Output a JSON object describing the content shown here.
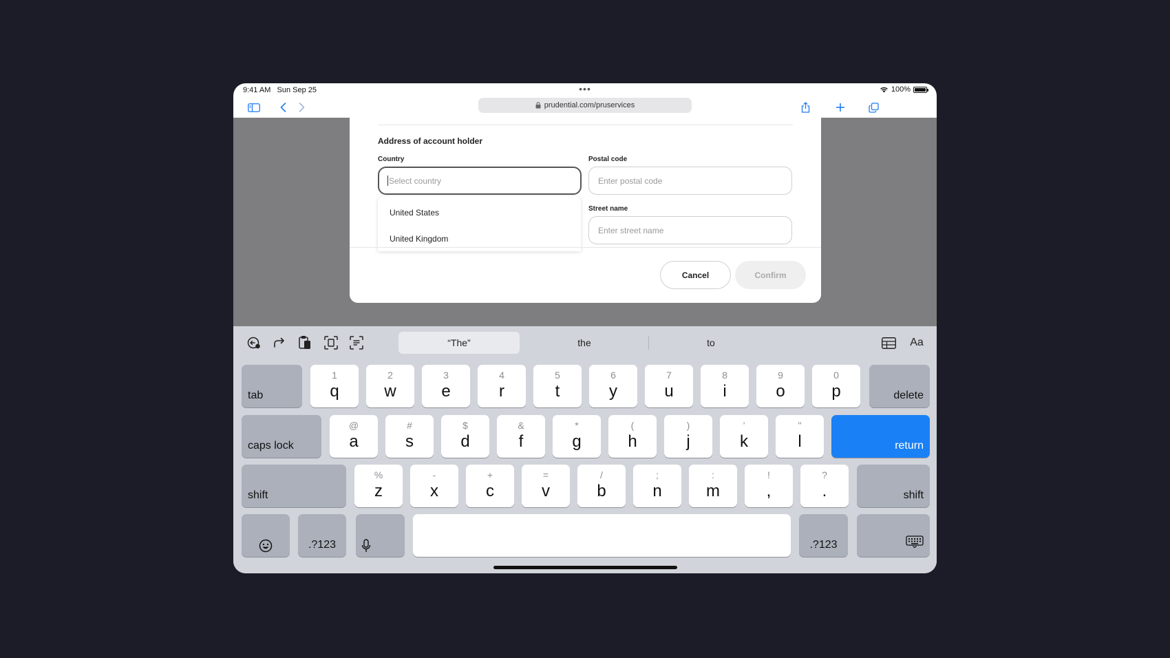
{
  "status": {
    "time": "9:41 AM",
    "date": "Sun Sep 25",
    "dots": "•••",
    "battery": "100%"
  },
  "browser": {
    "url": "prudential.com/pruservices"
  },
  "form": {
    "section_title": "Address of account holder",
    "country_label": "Country",
    "country_placeholder": "Select country",
    "postal_label": "Postal code",
    "postal_placeholder": "Enter postal code",
    "street_label": "Street name",
    "street_placeholder": "Enter street name",
    "country_options": [
      "United States",
      "United Kingdom"
    ],
    "cancel": "Cancel",
    "confirm": "Confirm"
  },
  "keyboard": {
    "suggestions": [
      "“The”",
      "the",
      "to"
    ],
    "format_label": "Aa",
    "row1": [
      {
        "alt": "1",
        "main": "q"
      },
      {
        "alt": "2",
        "main": "w"
      },
      {
        "alt": "3",
        "main": "e"
      },
      {
        "alt": "4",
        "main": "r"
      },
      {
        "alt": "5",
        "main": "t"
      },
      {
        "alt": "6",
        "main": "y"
      },
      {
        "alt": "7",
        "main": "u"
      },
      {
        "alt": "8",
        "main": "i"
      },
      {
        "alt": "9",
        "main": "o"
      },
      {
        "alt": "0",
        "main": "p"
      }
    ],
    "row2": [
      {
        "alt": "@",
        "main": "a"
      },
      {
        "alt": "#",
        "main": "s"
      },
      {
        "alt": "$",
        "main": "d"
      },
      {
        "alt": "&",
        "main": "f"
      },
      {
        "alt": "*",
        "main": "g"
      },
      {
        "alt": "(",
        "main": "h"
      },
      {
        "alt": ")",
        "main": "j"
      },
      {
        "alt": "’",
        "main": "k"
      },
      {
        "alt": "\"",
        "main": "l"
      }
    ],
    "row3": [
      {
        "alt": "%",
        "main": "z"
      },
      {
        "alt": "-",
        "main": "x"
      },
      {
        "alt": "+",
        "main": "c"
      },
      {
        "alt": "=",
        "main": "v"
      },
      {
        "alt": "/",
        "main": "b"
      },
      {
        "alt": ";",
        "main": "n"
      },
      {
        "alt": ":",
        "main": "m"
      },
      {
        "alt": "!",
        "main": ","
      },
      {
        "alt": "?",
        "main": "."
      }
    ],
    "tab": "tab",
    "delete": "delete",
    "caps_lock": "caps lock",
    "return": "return",
    "shift": "shift",
    "numbers": ".?123"
  },
  "colors": {
    "accent": "#1a80f5",
    "keyboard_bg": "#d1d4da",
    "backdrop": "#7e7e80"
  }
}
